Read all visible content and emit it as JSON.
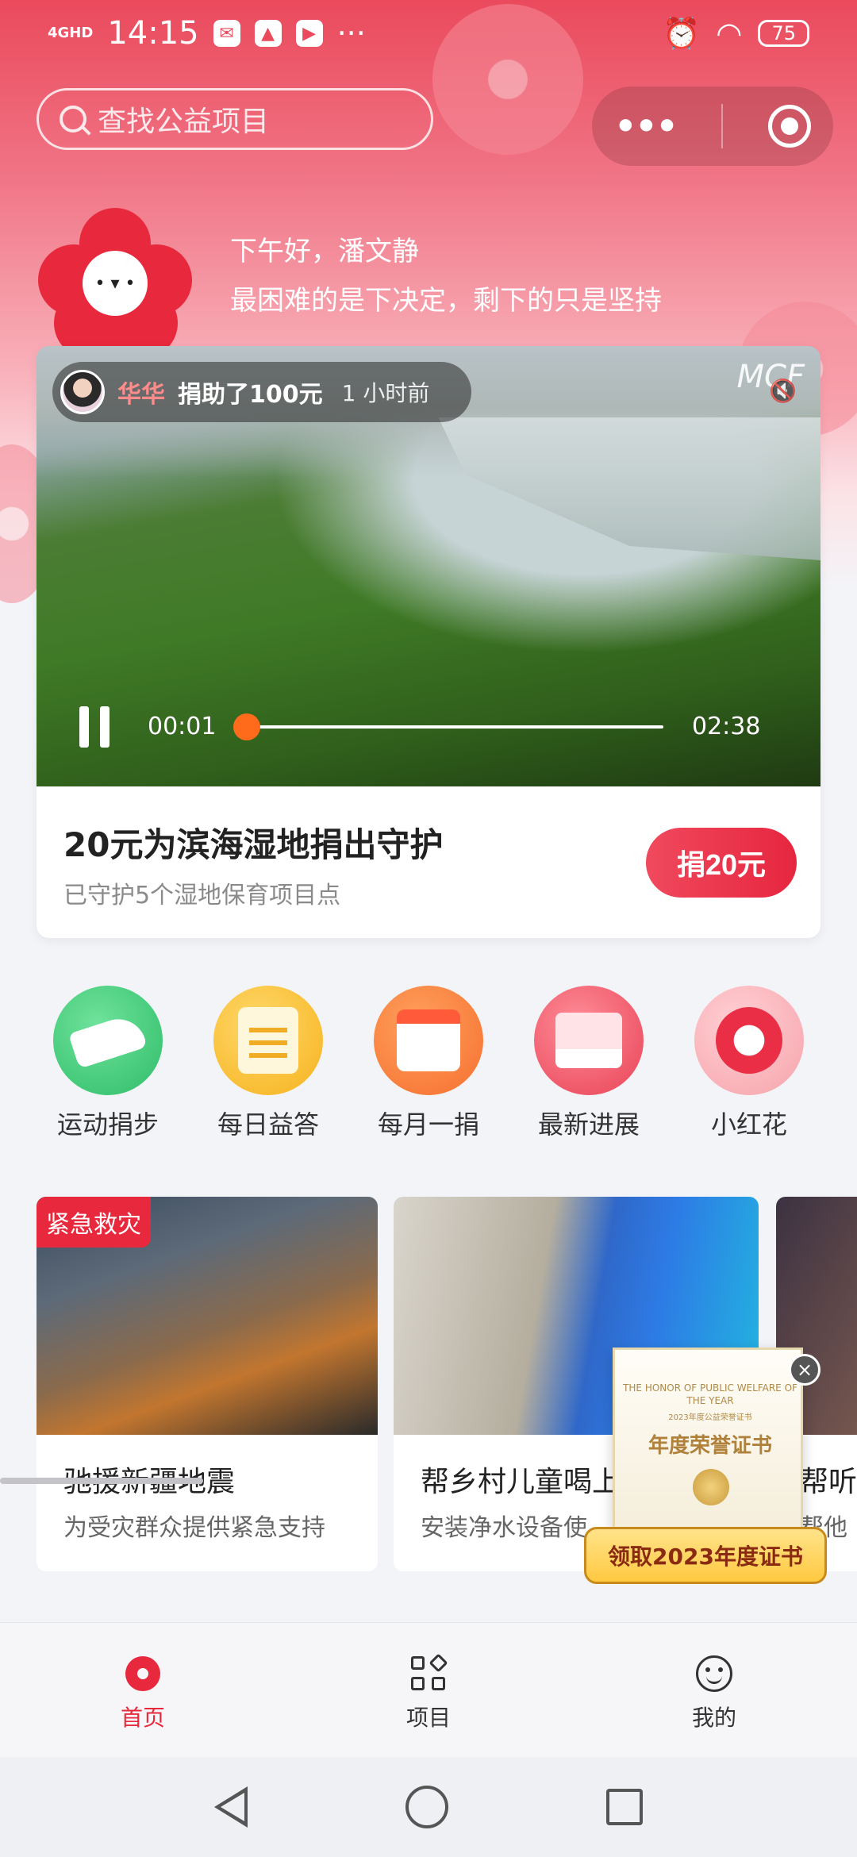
{
  "status_bar": {
    "network": "4GHD",
    "time": "14:15",
    "more": "···",
    "battery": "75"
  },
  "search": {
    "placeholder": "查找公益项目"
  },
  "capsule": {
    "more": "•••"
  },
  "greeting": {
    "line1": "下午好，潘文静",
    "line2": "最困难的是下决定，剩下的只是坚持"
  },
  "featured": {
    "donor_name": "华华",
    "donation_text": "捐助了100元",
    "time_ago": "1 小时前",
    "logo_text": "MCF",
    "video": {
      "current_time": "00:01",
      "duration": "02:38",
      "progress": 0.01
    },
    "title": "20元为滨海湿地捐出守护",
    "subtitle": "已守护5个湿地保育项目点",
    "donate_button": "捐20元"
  },
  "quick_actions": [
    {
      "label": "运动捐步",
      "icon": "sneaker-icon"
    },
    {
      "label": "每日益答",
      "icon": "quiz-icon"
    },
    {
      "label": "每月一捐",
      "icon": "calendar-icon"
    },
    {
      "label": "最新进展",
      "icon": "inbox-icon"
    },
    {
      "label": "小红花",
      "icon": "flower-icon"
    }
  ],
  "projects": [
    {
      "badge": "紧急救灾",
      "title": "驰援新疆地震",
      "subtitle": "为受灾群众提供紧急支持"
    },
    {
      "title": "帮乡村儿童喝上",
      "subtitle": "安装净水设备使"
    },
    {
      "title": "帮听",
      "subtitle": "帮他"
    }
  ],
  "certificate": {
    "english": "THE HONOR OF PUBLIC WELFARE OF THE YEAR",
    "chinese_small": "2023年度公益荣誉证书",
    "title": "年度荣誉证书",
    "button": "领取2023年度证书",
    "close": "×"
  },
  "tabbar": [
    {
      "label": "首页",
      "icon": "home-flower-icon",
      "active": true
    },
    {
      "label": "项目",
      "icon": "grid-icon",
      "active": false
    },
    {
      "label": "我的",
      "icon": "smile-icon",
      "active": false
    }
  ],
  "colors": {
    "accent": "#e8283c",
    "progress": "#ff6b1a",
    "header_gradient_top": "#ea4a5c"
  }
}
